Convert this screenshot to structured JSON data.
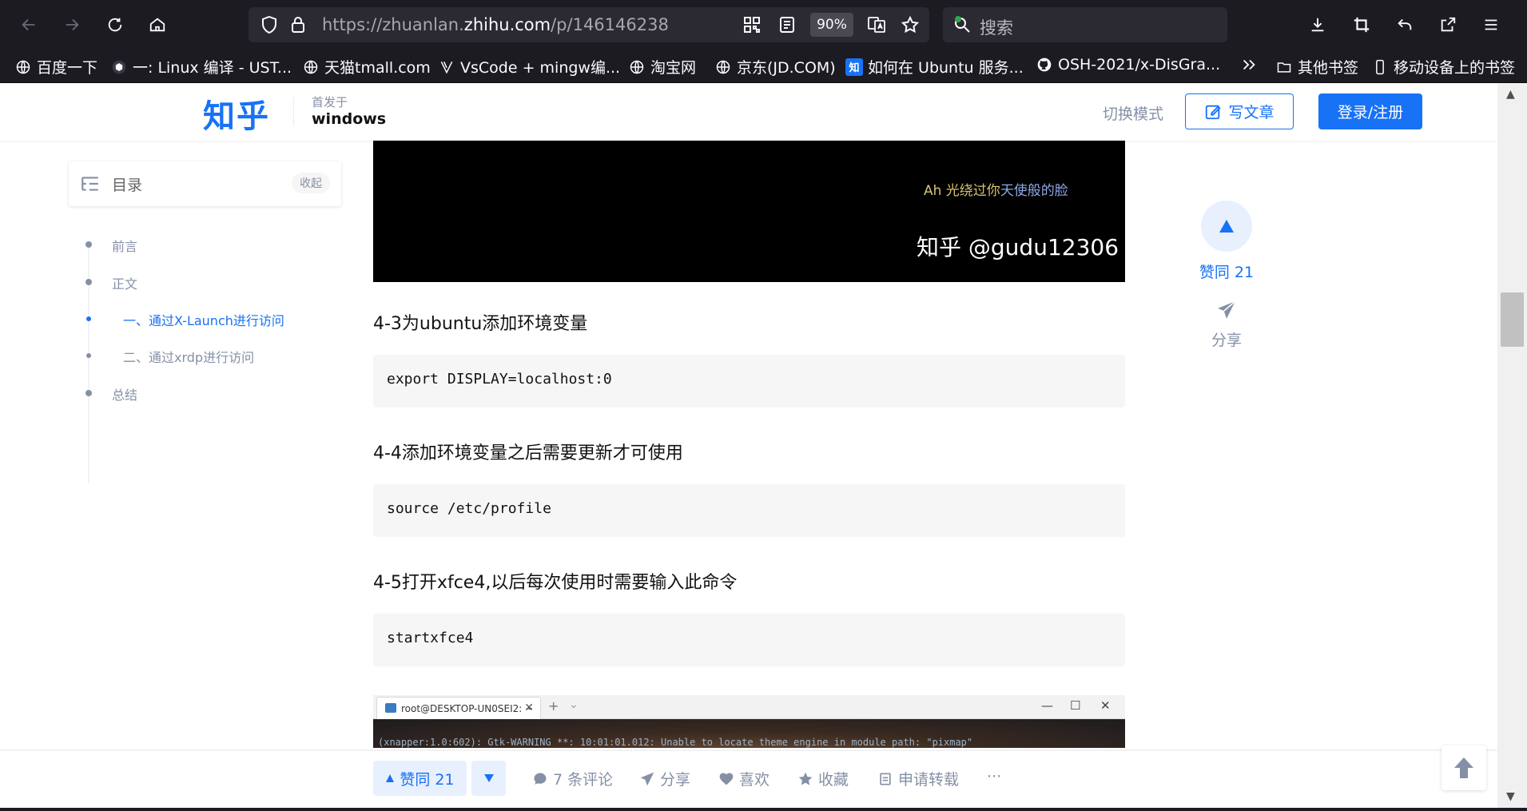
{
  "browser": {
    "url_prefix": "https://zhuanlan.",
    "url_domain": "zhihu.com",
    "url_path": "/p/146146238",
    "zoom": "90%",
    "search_placeholder": "搜索"
  },
  "bookmarks": [
    {
      "label": "百度一下",
      "icon": "globe-icon"
    },
    {
      "label": "一: Linux 编译 - UST...",
      "icon": "site-icon"
    },
    {
      "label": "天猫tmall.com",
      "icon": "globe-icon"
    },
    {
      "label": "VsCode + mingw编...",
      "icon": "site-icon"
    },
    {
      "label": "淘宝网",
      "icon": "globe-icon"
    },
    {
      "label": "京东(JD.COM)",
      "icon": "globe-icon"
    },
    {
      "label": "如何在 Ubuntu 服务...",
      "icon": "zhihu-icon"
    },
    {
      "label": "OSH-2021/x-DisGra...",
      "icon": "github-icon"
    },
    {
      "label": "其他书签",
      "icon": "folder-icon"
    },
    {
      "label": "移动设备上的书签",
      "icon": "mobile-icon"
    }
  ],
  "header": {
    "logo": "知乎",
    "first_published": "首发于",
    "column": "windows",
    "switch_mode": "切换模式",
    "write": "写文章",
    "login": "登录/注册"
  },
  "toc": {
    "title": "目录",
    "collapse": "收起",
    "items": [
      {
        "label": "前言",
        "level": 1,
        "active": false
      },
      {
        "label": "正文",
        "level": 1,
        "active": false
      },
      {
        "label": "一、通过X-Launch进行访问",
        "level": 2,
        "active": true
      },
      {
        "label": "二、通过xrdp进行访问",
        "level": 2,
        "active": false
      },
      {
        "label": "总结",
        "level": 1,
        "active": false
      }
    ]
  },
  "article": {
    "hero_caption_a": "Ah 光绕过你",
    "hero_caption_b": "天使般的脸",
    "hero_watermark": "知乎 @gudu12306",
    "sections": [
      {
        "heading": "4-3为ubuntu添加环境变量",
        "code": "export DISPLAY=localhost:0"
      },
      {
        "heading": "4-4添加环境变量之后需要更新才可使用",
        "code": "source /etc/profile"
      },
      {
        "heading": "4-5打开xfce4,以后每次使用时需要输入此命令",
        "code": "startxfce4"
      }
    ],
    "terminal_tab": "root@DESKTOP-UN0SEI2: ~",
    "terminal_line": "(xnapper:1.0:602): Gtk-WARNING **: 10:01:01.012: Unable to locate theme engine in module path: \"pixmap\""
  },
  "side": {
    "vote_label": "赞同 21",
    "share_label": "分享"
  },
  "actions": {
    "vote": "赞同 21",
    "comments": "7 条评论",
    "share": "分享",
    "like": "喜欢",
    "favorite": "收藏",
    "repost": "申请转载",
    "more": "···"
  },
  "colors": {
    "brand": "#1772f6",
    "muted": "#8590a6",
    "browser_bg": "#1c1b22"
  }
}
